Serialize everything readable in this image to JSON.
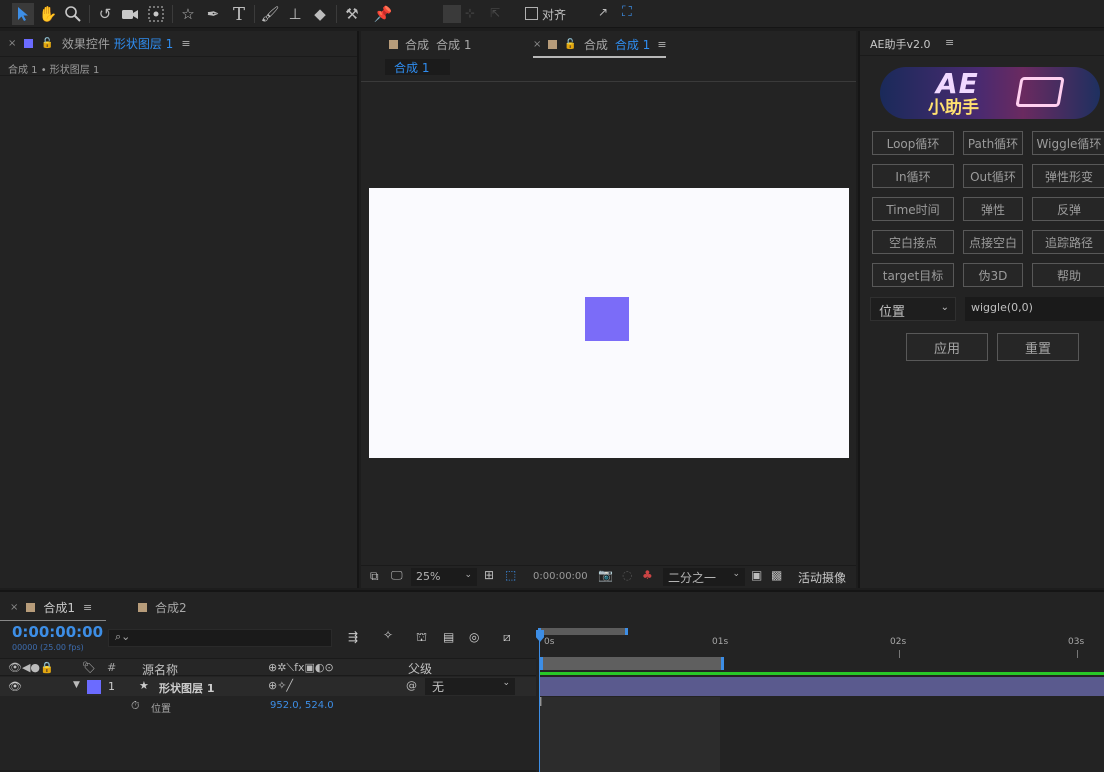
{
  "toolbar": {
    "align_label": "对齐",
    "icons": [
      "selection-tool",
      "hand-tool",
      "zoom-tool",
      "rotate-tool",
      "camera-tool",
      "pan-behind-tool",
      "star-shape-tool",
      "pen-tool",
      "type-tool",
      "brush-tool",
      "clone-stamp-tool",
      "eraser-tool",
      "roto-brush-tool",
      "puppet-pin-tool"
    ]
  },
  "effects_panel": {
    "tab_label": "效果控件",
    "layer_name": "形状图层 1",
    "breadcrumb": "合成 1 • 形状图层 1",
    "swatch_color": "#6b6bff"
  },
  "comp_panel": {
    "tab1_label": "合成",
    "tab1_name": "合成 1",
    "tab2_label": "合成",
    "tab2_name": "合成 1",
    "subtab": "合成 1",
    "swatch_color": "#b79c7a",
    "canvas_color": "#fafafe",
    "shape_color": "#7b6cf8",
    "zoom": "25%",
    "timecode": "0:00:00:00",
    "resolution": "二分之一",
    "camera": "活动摄像"
  },
  "ae_helper": {
    "title": "AE助手v2.0",
    "logo_text_top": "AE",
    "logo_text_bottom": "小助手",
    "buttons": [
      [
        "Loop循环",
        "Path循环",
        "Wiggle循环"
      ],
      [
        "In循环",
        "Out循环",
        "弹性形变"
      ],
      [
        "Time时间",
        "弹性",
        "反弹"
      ],
      [
        "空白接点",
        "点接空白",
        "追踪路径"
      ],
      [
        "target目标",
        "伪3D",
        "帮助"
      ]
    ],
    "property_select": "位置",
    "expression_value": "wiggle(0,0)",
    "apply_label": "应用",
    "reset_label": "重置"
  },
  "timeline": {
    "tab1": "合成1",
    "tab2": "合成2",
    "tab1_swatch": "#b79c7a",
    "timecode": "0:00:00:00",
    "frame_info": "00000 (25.00 fps)",
    "search_placeholder": "",
    "col_hash": "#",
    "col_source_name": "源名称",
    "col_parent": "父级",
    "layer_index": "1",
    "layer_name": "形状图层 1",
    "layer_color": "#6b6bff",
    "parent_value": "无",
    "property_name": "位置",
    "property_value": "952.0, 524.0",
    "ruler_marks": [
      "0s",
      "01s",
      "02s",
      "03s"
    ],
    "bar_color": "#5a5a8e",
    "green_line": "#28c828",
    "playhead_color": "#3d8ee6"
  }
}
